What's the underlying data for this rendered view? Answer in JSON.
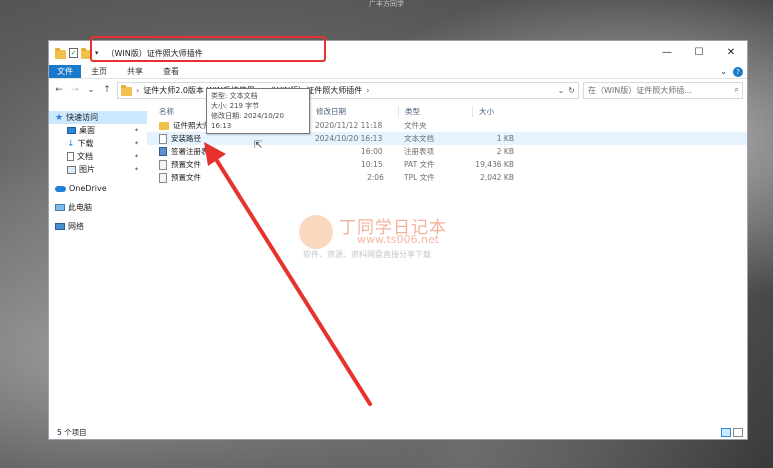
{
  "caption": "广丰方同学",
  "window": {
    "title": "（WIN版）证件照大师插件",
    "controls": {
      "minimize": "—",
      "maximize": "☐",
      "close": "✕"
    }
  },
  "ribbon": {
    "file": "文件",
    "tabs": [
      "主页",
      "共享",
      "查看"
    ]
  },
  "address": {
    "crumbs": [
      "证件大师2.0版本 WIN系统使用",
      "（WIN版）证件照大师插件"
    ],
    "sep": "›"
  },
  "search": {
    "placeholder": "在（WIN版）证件照大师插..."
  },
  "sidebar": {
    "quick": "快速访问",
    "items": [
      "桌面",
      "下载",
      "文档",
      "图片"
    ],
    "onedrive": "OneDrive",
    "pc": "此电脑",
    "network": "网络"
  },
  "columns": {
    "name": "名称",
    "date": "修改日期",
    "type": "类型",
    "size": "大小"
  },
  "files": [
    {
      "name": "证件照大师2.0",
      "date": "2020/11/12 11:18",
      "type": "文件夹",
      "size": "",
      "icon": "folder"
    },
    {
      "name": "安装路径",
      "date": "2024/10/20 16:13",
      "type": "文本文档",
      "size": "1 KB",
      "icon": "doc"
    },
    {
      "name": "签署注册表",
      "date": "16:00",
      "type": "注册表项",
      "size": "2 KB",
      "icon": "reg"
    },
    {
      "name": "预置文件",
      "date": "10:15",
      "type": "PAT 文件",
      "size": "19,436 KB",
      "icon": "file"
    },
    {
      "name": "预置文件",
      "date": "2:06",
      "type": "TPL 文件",
      "size": "2,042 KB",
      "icon": "file"
    }
  ],
  "tooltip": {
    "type": "类型: 文本文档",
    "size": "大小: 219 字节",
    "date": "修改日期: 2024/10/20 16:13"
  },
  "watermark": {
    "title": "丁同学日记本",
    "url": "www.ts006.net",
    "slogan": "软件、资源、资料网盘直接分享下载"
  },
  "status": {
    "count": "5 个项目"
  },
  "accent_color": "#1979ca",
  "annotation_color": "#e8322d"
}
